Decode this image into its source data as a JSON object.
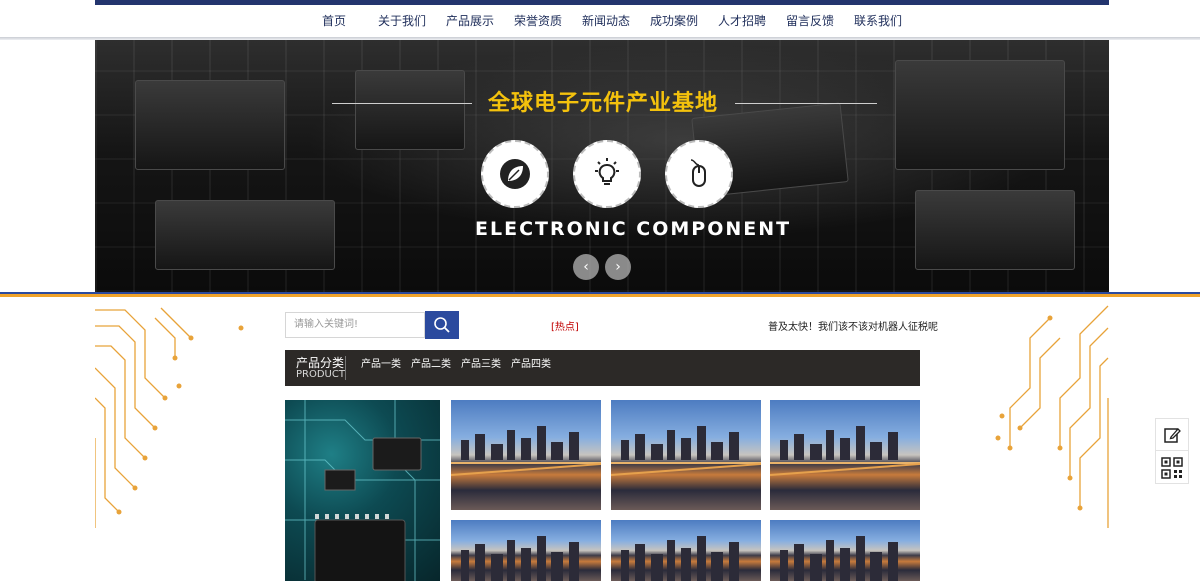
{
  "nav": {
    "items": [
      "首页",
      "关于我们",
      "产品展示",
      "荣誉资质",
      "新闻动态",
      "成功案例",
      "人才招聘",
      "留言反馈",
      "联系我们"
    ]
  },
  "banner": {
    "title": "全球电子元件产业基地",
    "subtitle": "ELECTRONIC COMPONENT",
    "icons": [
      "leaf-icon",
      "lightbulb-icon",
      "mouse-icon"
    ],
    "prev_label": "‹",
    "next_label": "›"
  },
  "search": {
    "placeholder": "请输入关键词!",
    "hot_label": "[热点]",
    "ticker_text": "普及太快！我们该不该对机器人征税呢"
  },
  "categories": {
    "title": "产品分类",
    "subtitle": "PRODUCT",
    "items": [
      "产品一类",
      "产品二类",
      "产品三类",
      "产品四类"
    ]
  },
  "colors": {
    "nav_accent": "#23356e",
    "divider_blue": "#2b4a9e",
    "divider_orange": "#f0a32a",
    "banner_title": "#f4c20d",
    "hot_red": "#c00000",
    "category_bar": "#2c2927"
  }
}
